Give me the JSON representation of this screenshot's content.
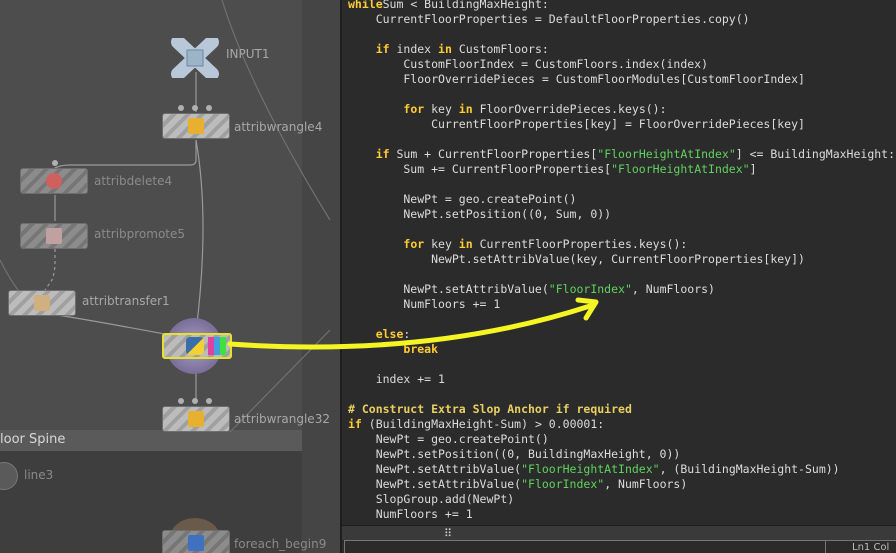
{
  "network": {
    "netbox_title": "loor Spine",
    "nodes": [
      {
        "id": "input1",
        "label": "INPUT1",
        "icon": "input-x-icon"
      },
      {
        "id": "attribwrangle4",
        "label": "attribwrangle4",
        "icon": "wrangle-icon"
      },
      {
        "id": "attribdelete4",
        "label": "attribdelete4",
        "icon": "delete-icon"
      },
      {
        "id": "attribpromote5",
        "label": "attribpromote5",
        "icon": "promote-icon"
      },
      {
        "id": "attribtransfer1",
        "label": "attribtransfer1",
        "icon": "transfer-icon"
      },
      {
        "id": "python1",
        "label": "",
        "icon": "python-icon"
      },
      {
        "id": "attribwrangle32",
        "label": "attribwrangle32",
        "icon": "wrangle-icon"
      },
      {
        "id": "line3",
        "label": "line3",
        "icon": "line-icon"
      },
      {
        "id": "foreach_begin9",
        "label": "foreach_begin9",
        "icon": "foreach-icon"
      }
    ]
  },
  "editor": {
    "lines": [
      [
        [
          "kw",
          "while"
        ],
        [
          "",
          "Sum < BuildingMaxHeight:"
        ]
      ],
      [
        [
          "",
          "    CurrentFloorProperties = DefaultFloorProperties.copy()"
        ]
      ],
      [
        [
          "",
          ""
        ]
      ],
      [
        [
          "",
          "    "
        ],
        [
          "kw",
          "if"
        ],
        [
          "",
          " index "
        ],
        [
          "kw",
          "in"
        ],
        [
          "",
          " CustomFloors:"
        ]
      ],
      [
        [
          "",
          "        CustomFloorIndex = CustomFloors.index(index)"
        ]
      ],
      [
        [
          "",
          "        FloorOverridePieces = CustomFloorModules[CustomFloorIndex]"
        ]
      ],
      [
        [
          "",
          ""
        ]
      ],
      [
        [
          "",
          "        "
        ],
        [
          "kw",
          "for"
        ],
        [
          "",
          " key "
        ],
        [
          "kw",
          "in"
        ],
        [
          "",
          " FloorOverridePieces.keys():"
        ]
      ],
      [
        [
          "",
          "            CurrentFloorProperties[key] = FloorOverridePieces[key]"
        ]
      ],
      [
        [
          "",
          ""
        ]
      ],
      [
        [
          "",
          "    "
        ],
        [
          "kw",
          "if"
        ],
        [
          "",
          " Sum + CurrentFloorProperties["
        ],
        [
          "st",
          "\"FloorHeightAtIndex\""
        ],
        [
          "",
          "] <= BuildingMaxHeight:"
        ]
      ],
      [
        [
          "",
          "        Sum += CurrentFloorProperties["
        ],
        [
          "st",
          "\"FloorHeightAtIndex\""
        ],
        [
          "",
          "]"
        ]
      ],
      [
        [
          "",
          ""
        ]
      ],
      [
        [
          "",
          "        NewPt = geo.createPoint()"
        ]
      ],
      [
        [
          "",
          "        NewPt.setPosition((0, Sum, 0))"
        ]
      ],
      [
        [
          "",
          ""
        ]
      ],
      [
        [
          "",
          "        "
        ],
        [
          "kw",
          "for"
        ],
        [
          "",
          " key "
        ],
        [
          "kw",
          "in"
        ],
        [
          "",
          " CurrentFloorProperties.keys():"
        ]
      ],
      [
        [
          "",
          "            NewPt.setAttribValue(key, CurrentFloorProperties[key])"
        ]
      ],
      [
        [
          "",
          ""
        ]
      ],
      [
        [
          "",
          "        NewPt.setAttribValue("
        ],
        [
          "st",
          "\"FloorIndex\""
        ],
        [
          "",
          ", NumFloors)"
        ]
      ],
      [
        [
          "",
          "        NumFloors += 1"
        ]
      ],
      [
        [
          "",
          ""
        ]
      ],
      [
        [
          "",
          "    "
        ],
        [
          "kw",
          "else"
        ],
        [
          "",
          ":"
        ]
      ],
      [
        [
          "",
          "        "
        ],
        [
          "kw",
          "break"
        ]
      ],
      [
        [
          "",
          ""
        ]
      ],
      [
        [
          "",
          "    index += 1"
        ]
      ],
      [
        [
          "",
          ""
        ]
      ],
      [
        [
          "cm",
          "# Construct Extra Slop Anchor if required"
        ]
      ],
      [
        [
          "kw",
          "if"
        ],
        [
          "",
          " (BuildingMaxHeight-Sum) > 0.00001:"
        ]
      ],
      [
        [
          "",
          "    NewPt = geo.createPoint()"
        ]
      ],
      [
        [
          "",
          "    NewPt.setPosition((0, BuildingMaxHeight, 0))"
        ]
      ],
      [
        [
          "",
          "    NewPt.setAttribValue("
        ],
        [
          "st",
          "\"FloorHeightAtIndex\""
        ],
        [
          "",
          ", (BuildingMaxHeight-Sum))"
        ]
      ],
      [
        [
          "",
          "    NewPt.setAttribValue("
        ],
        [
          "st",
          "\"FloorIndex\""
        ],
        [
          "",
          ", NumFloors)"
        ]
      ],
      [
        [
          "",
          "    SlopGroup.add(NewPt)"
        ]
      ],
      [
        [
          "",
          "    NumFloors += 1"
        ]
      ]
    ],
    "splitter_grip": "⠿",
    "status_text": "Ln1 Col"
  },
  "colors": {
    "keyword": "#ffcc33",
    "string": "#5fd35f",
    "comment": "#e8d060",
    "annotation_arrow": "#f5f523"
  }
}
